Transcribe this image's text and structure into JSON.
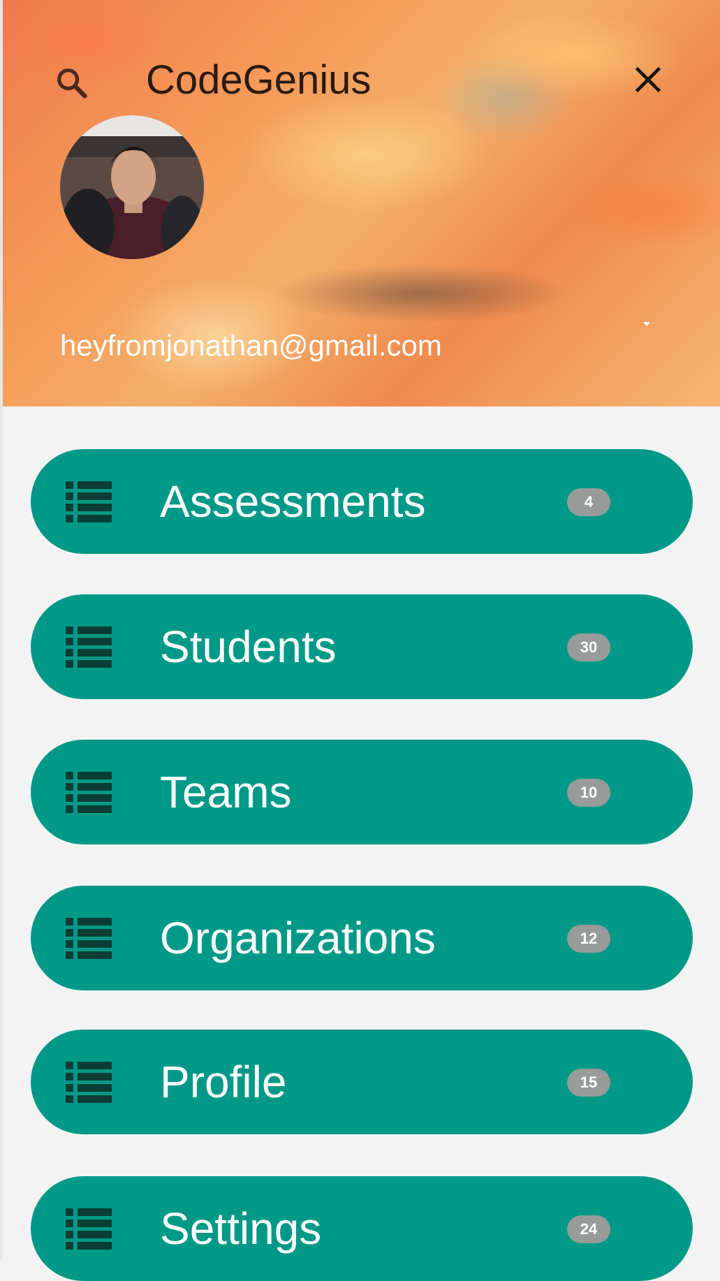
{
  "app": {
    "title": "CodeGenius"
  },
  "account": {
    "email": "heyfromjonathan@gmail.com"
  },
  "header": {
    "search_icon": "search-icon",
    "close_icon": "close-icon",
    "dropdown_icon": "chevron-down-icon"
  },
  "nav": {
    "items": [
      {
        "label": "Assessments",
        "count": "4",
        "icon": "list-icon"
      },
      {
        "label": "Students",
        "count": "30",
        "icon": "list-icon"
      },
      {
        "label": "Teams",
        "count": "10",
        "icon": "list-icon"
      },
      {
        "label": "Organizations",
        "count": "12",
        "icon": "list-icon"
      },
      {
        "label": "Profile",
        "count": "15",
        "icon": "list-icon"
      },
      {
        "label": "Settings",
        "count": "24",
        "icon": "list-icon"
      }
    ]
  },
  "colors": {
    "accent": "#009987",
    "badge": "#979b99",
    "background": "#f4f3f4",
    "icon_dark": "#0b3d36"
  }
}
